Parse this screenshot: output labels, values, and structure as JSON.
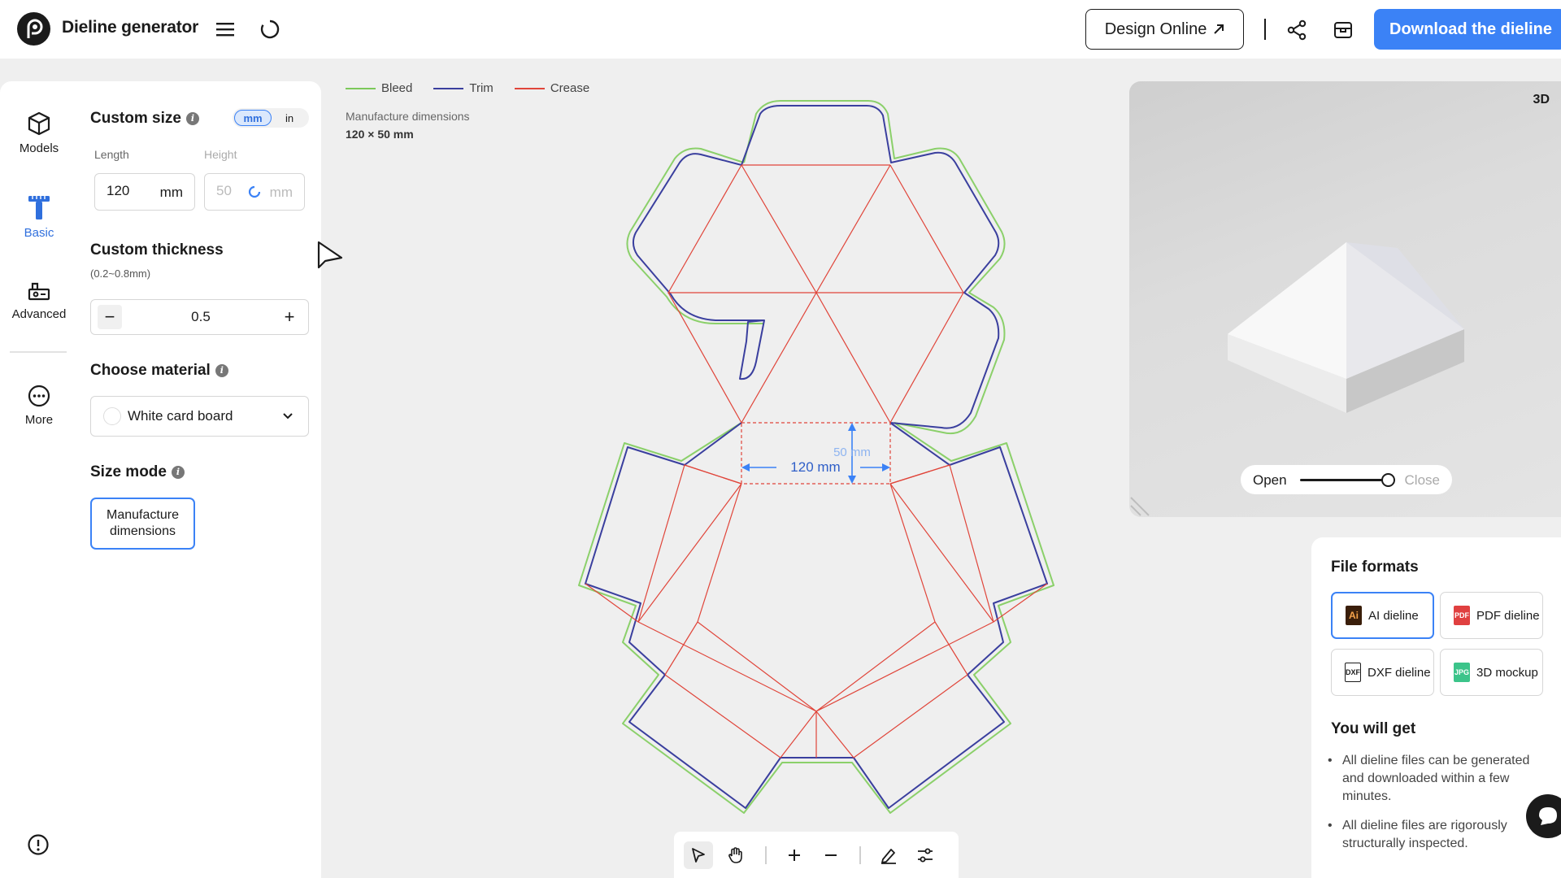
{
  "header": {
    "app_title": "Dieline generator",
    "design_online_label": "Design Online",
    "download_label": "Download the dieline"
  },
  "rail": {
    "items": [
      {
        "label": "Models",
        "icon": "cube-icon"
      },
      {
        "label": "Basic",
        "icon": "ruler-icon",
        "active": true
      },
      {
        "label": "Advanced",
        "icon": "advanced-icon"
      },
      {
        "label": "More",
        "icon": "more-icon"
      }
    ]
  },
  "panel": {
    "custom_size": {
      "title": "Custom size",
      "units": [
        "mm",
        "in"
      ],
      "selected_unit": "mm",
      "length_label": "Length",
      "length_value": "120",
      "length_unit": "mm",
      "height_label": "Height",
      "height_value": "50",
      "height_unit": "mm"
    },
    "thickness": {
      "title": "Custom thickness",
      "range": "(0.2~0.8mm)",
      "value": "0.5",
      "minus": "−",
      "plus": "+"
    },
    "material": {
      "title": "Choose material",
      "selected": "White card board"
    },
    "size_mode": {
      "title": "Size mode",
      "option_line1": "Manufacture",
      "option_line2": "dimensions"
    }
  },
  "canvas": {
    "legend": [
      {
        "label": "Bleed",
        "color": "#7cc95a"
      },
      {
        "label": "Trim",
        "color": "#3a3f9e"
      },
      {
        "label": "Crease",
        "color": "#e0453a"
      }
    ],
    "manufacture_label": "Manufacture dimensions",
    "manufacture_value": "120 × 50 mm",
    "dim_width": "120 mm",
    "dim_height": "50 mm"
  },
  "preview": {
    "badge": "3D",
    "open_label": "Open",
    "close_label": "Close",
    "slider_value": 1.0
  },
  "formats": {
    "title": "File formats",
    "options": [
      {
        "label": "AI dieline",
        "icon_text": "Ai",
        "color": "#3a1e0a",
        "selected": true
      },
      {
        "label": "PDF dieline",
        "icon_text": "PDF",
        "color": "#e04040"
      },
      {
        "label": "DXF dieline",
        "icon_text": "DXF",
        "color": "#1b1b1b"
      },
      {
        "label": "3D mockup",
        "icon_text": "JPG",
        "color": "#3cc48a"
      }
    ],
    "you_get_title": "You will get",
    "benefits": [
      "All dieline files can be generated and downloaded within a few minutes.",
      "All dieline files are rigorously structurally inspected."
    ]
  }
}
